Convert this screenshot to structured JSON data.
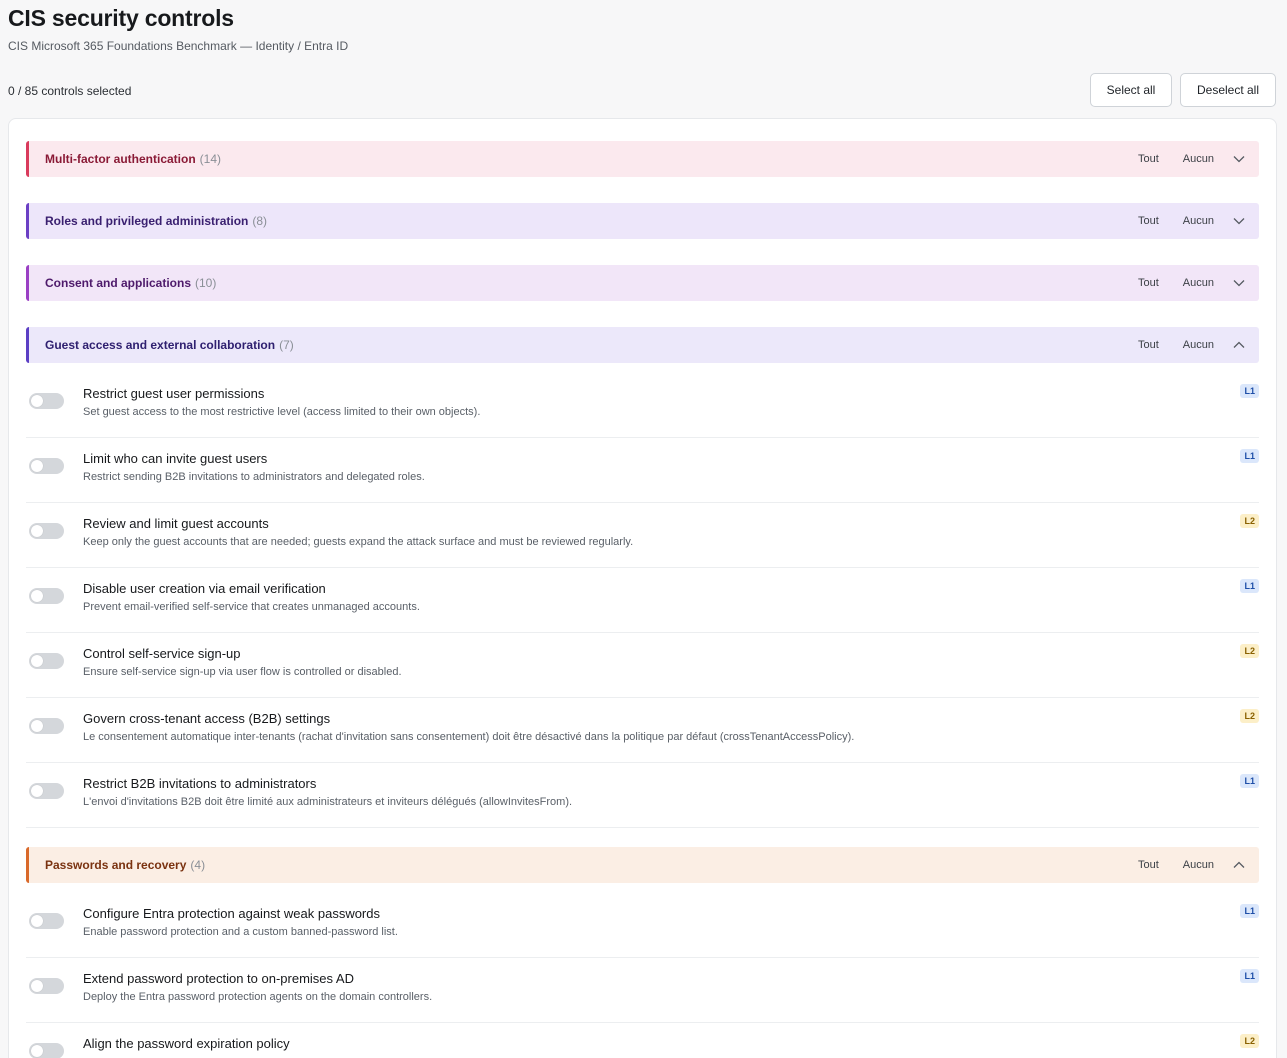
{
  "header": {
    "title": "CIS security controls",
    "subtitle": "CIS Microsoft 365 Foundations Benchmark — Identity / Entra ID",
    "selected_count": "0 / 85 controls selected",
    "select_all_label": "Select all",
    "deselect_all_label": "Deselect all"
  },
  "group_actions": {
    "all_label": "Tout",
    "none_label": "Aucun"
  },
  "groups": [
    {
      "name": "Multi-factor authentication",
      "count": "(14)",
      "expanded": false,
      "accent": "#d93a5c",
      "bg": "#fbe9ee",
      "text": "#8a1a36"
    },
    {
      "name": "Roles and privileged administration",
      "count": "(8)",
      "expanded": false,
      "accent": "#6b3fc4",
      "bg": "#ede6fa",
      "text": "#3a2070"
    },
    {
      "name": "Consent and applications",
      "count": "(10)",
      "expanded": false,
      "accent": "#9a3fc4",
      "bg": "#f2e6f8",
      "text": "#4e1a6b"
    },
    {
      "name": "Guest access and external collaboration",
      "count": "(7)",
      "expanded": true,
      "accent": "#5b3fc4",
      "bg": "#ece8fa",
      "text": "#2f2070",
      "controls": [
        {
          "title": "Restrict guest user permissions",
          "desc": "Set guest access to the most restrictive level (access limited to their own objects).",
          "level": "L1"
        },
        {
          "title": "Limit who can invite guest users",
          "desc": "Restrict sending B2B invitations to administrators and delegated roles.",
          "level": "L1"
        },
        {
          "title": "Review and limit guest accounts",
          "desc": "Keep only the guest accounts that are needed; guests expand the attack surface and must be reviewed regularly.",
          "level": "L2"
        },
        {
          "title": "Disable user creation via email verification",
          "desc": "Prevent email-verified self-service that creates unmanaged accounts.",
          "level": "L1"
        },
        {
          "title": "Control self-service sign-up",
          "desc": "Ensure self-service sign-up via user flow is controlled or disabled.",
          "level": "L2"
        },
        {
          "title": "Govern cross-tenant access (B2B) settings",
          "desc": "Le consentement automatique inter-tenants (rachat d'invitation sans consentement) doit être désactivé dans la politique par défaut (crossTenantAccessPolicy).",
          "level": "L2"
        },
        {
          "title": "Restrict B2B invitations to administrators",
          "desc": "L'envoi d'invitations B2B doit être limité aux administrateurs et inviteurs délégués (allowInvitesFrom).",
          "level": "L1"
        }
      ]
    },
    {
      "name": "Passwords and recovery",
      "count": "(4)",
      "expanded": true,
      "accent": "#d9692a",
      "bg": "#fbeee4",
      "text": "#7a3210",
      "controls": [
        {
          "title": "Configure Entra protection against weak passwords",
          "desc": "Enable password protection and a custom banned-password list.",
          "level": "L1"
        },
        {
          "title": "Extend password protection to on-premises AD",
          "desc": "Deploy the Entra password protection agents on the domain controllers.",
          "level": "L1"
        },
        {
          "title": "Align the password expiration policy",
          "desc": "",
          "level": "L2"
        }
      ]
    }
  ]
}
